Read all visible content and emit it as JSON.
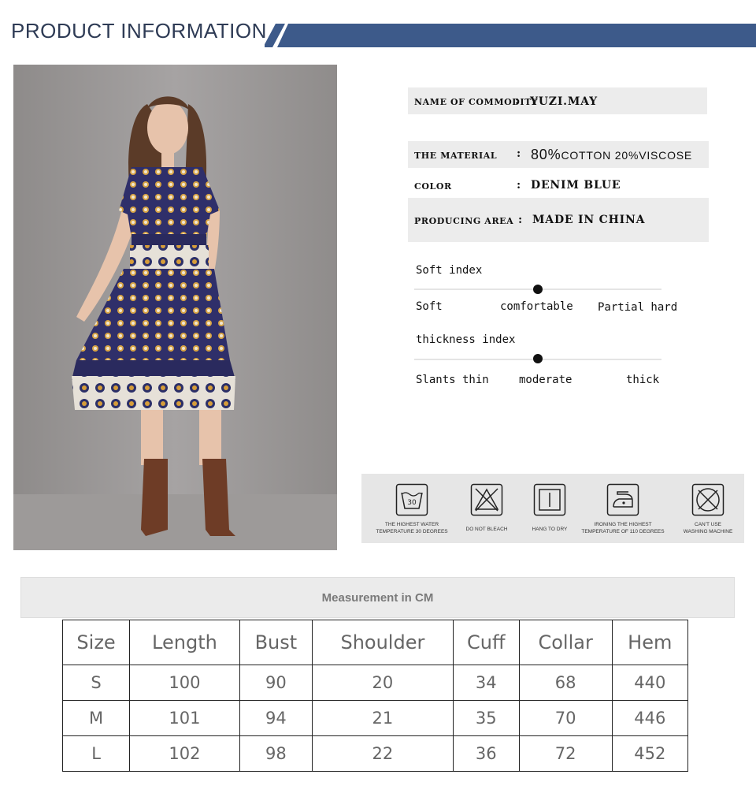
{
  "header": {
    "title": "PRODUCT INFORMATION",
    "accent_color": "#3d5a8a"
  },
  "info": {
    "name_label": "NAME OF COMMODITY",
    "name_value": "YUZI.MAY",
    "material_label": "THE MATERIAL",
    "material_value_pct1": "80%",
    "material_value_text1": "COTTON ",
    "material_value_text2": "20%VISCOSE",
    "color_label": "COLOR",
    "color_value": "DENIM BLUE",
    "area_label": "PRODUCING AREA",
    "area_value": "MADE IN CHINA",
    "colon": ":",
    "colon_short": ": "
  },
  "soft_index": {
    "title": "Soft index",
    "low": "Soft",
    "mid": "comfortable",
    "high": "Partial hard",
    "level": 0.5
  },
  "thickness_index": {
    "title": "thickness index",
    "low": "Slants thin",
    "mid": "moderate",
    "high": "thick",
    "level": 0.5
  },
  "care": [
    {
      "icon": "wash-30-icon",
      "caption_1": "THE HIGHEST WATER",
      "caption_2": "TEMPERATURE 30 DEGREES",
      "number": "30"
    },
    {
      "icon": "no-bleach-icon",
      "caption_1": "DO NOT BLEACH",
      "caption_2": ""
    },
    {
      "icon": "hang-dry-icon",
      "caption_1": "HANG TO DRY",
      "caption_2": ""
    },
    {
      "icon": "iron-icon",
      "caption_1": "IRONING THE HIGHEST",
      "caption_2": "TEMPERATURE OF 110 DEGREES"
    },
    {
      "icon": "no-machine-wash-icon",
      "caption_1": "CAN'T USE",
      "caption_2": "WASHING MACHINE"
    }
  ],
  "measurement": {
    "title": "Measurement in CM",
    "headers": [
      "Size",
      "Length",
      "Bust",
      "Shoulder",
      "Cuff",
      "Collar",
      "Hem"
    ],
    "rows": [
      [
        "S",
        "100",
        "90",
        "20",
        "34",
        "68",
        "440"
      ],
      [
        "M",
        "101",
        "94",
        "21",
        "35",
        "70",
        "446"
      ],
      [
        "L",
        "102",
        "98",
        "22",
        "36",
        "72",
        "452"
      ]
    ]
  }
}
